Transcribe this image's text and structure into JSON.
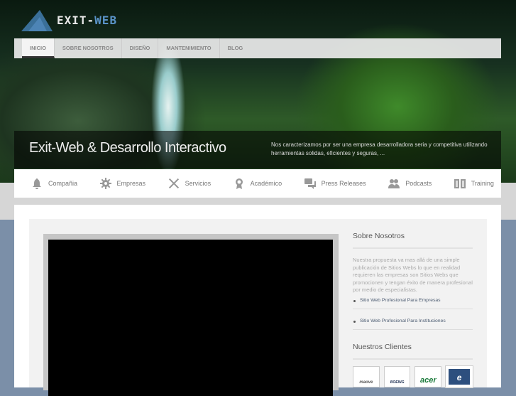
{
  "logo": {
    "text_a": "EXIT-",
    "text_b": "WEB"
  },
  "nav": [
    "INICIO",
    "SOBRE NOSOTROS",
    "DISEÑO",
    "MANTENIMIENTO",
    "BLOG"
  ],
  "banner": {
    "title": "Exit-Web & Desarrollo Interactivo",
    "text": "Nos caracterizamos por ser una empresa desarrolladora seria y competitiva utilizando herramientas solidas, eficientes y seguras, ..."
  },
  "iconbar": [
    {
      "label": "Compañia",
      "icon": "bell-icon"
    },
    {
      "label": "Empresas",
      "icon": "gear-icon"
    },
    {
      "label": "Servicios",
      "icon": "tools-icon"
    },
    {
      "label": "Académico",
      "icon": "award-icon"
    },
    {
      "label": "Press Releases",
      "icon": "chat-icon"
    },
    {
      "label": "Podcasts",
      "icon": "users-icon"
    },
    {
      "label": "Training",
      "icon": "book-icon"
    }
  ],
  "sidebar": {
    "about_title": "Sobre Nosotros",
    "about_text": "Nuestra propuesta va mas allá de una simple publicación de Sitios Webs lo que en realidad requieren las empresas son Sitios Webs que promocionen y tengan éxito de manera profesional por medio de especialistas.",
    "links": [
      "Sitio Web Profesional Para Empresas",
      "Sitio Web Profesional Para Instituciones"
    ],
    "clients_title": "Nuestros Clientes",
    "clients": [
      "maove",
      "BOEING",
      "acer",
      "e"
    ]
  }
}
